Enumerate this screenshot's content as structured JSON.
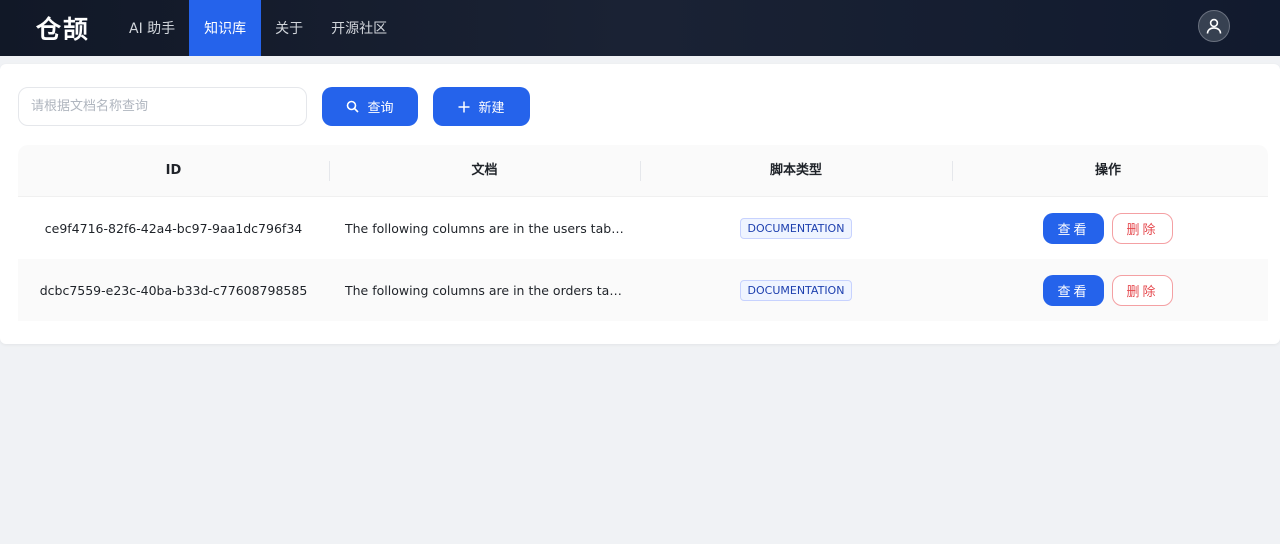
{
  "header": {
    "logo": "仓颉",
    "nav": [
      {
        "label": "AI 助手"
      },
      {
        "label": "知识库"
      },
      {
        "label": "关于"
      },
      {
        "label": "开源社区"
      }
    ],
    "active_nav": "知识库",
    "avatar_icon": "user-icon"
  },
  "toolbar": {
    "search_placeholder": "请根据文档名称查询",
    "search_value": "",
    "query_label": "查询",
    "query_icon": "search-icon",
    "new_label": "新建",
    "new_icon": "plus-icon"
  },
  "table": {
    "columns": [
      "ID",
      "文档",
      "脚本类型",
      "操作"
    ],
    "rows": [
      {
        "id": "ce9f4716-82f6-42a4-bc97-9aa1dc796f34",
        "document": "The following columns are in the users table i...",
        "type": "DOCUMENTATION",
        "view": "查看",
        "delete": "删除"
      },
      {
        "id": "dcbc7559-e23c-40ba-b33d-c77608798585",
        "document": "The following columns are in the orders table...",
        "type": "DOCUMENTATION",
        "view": "查看",
        "delete": "删除"
      }
    ]
  },
  "colors": {
    "primary": "#2563eb",
    "danger": "#e5484d",
    "header_bg": "#111827"
  }
}
